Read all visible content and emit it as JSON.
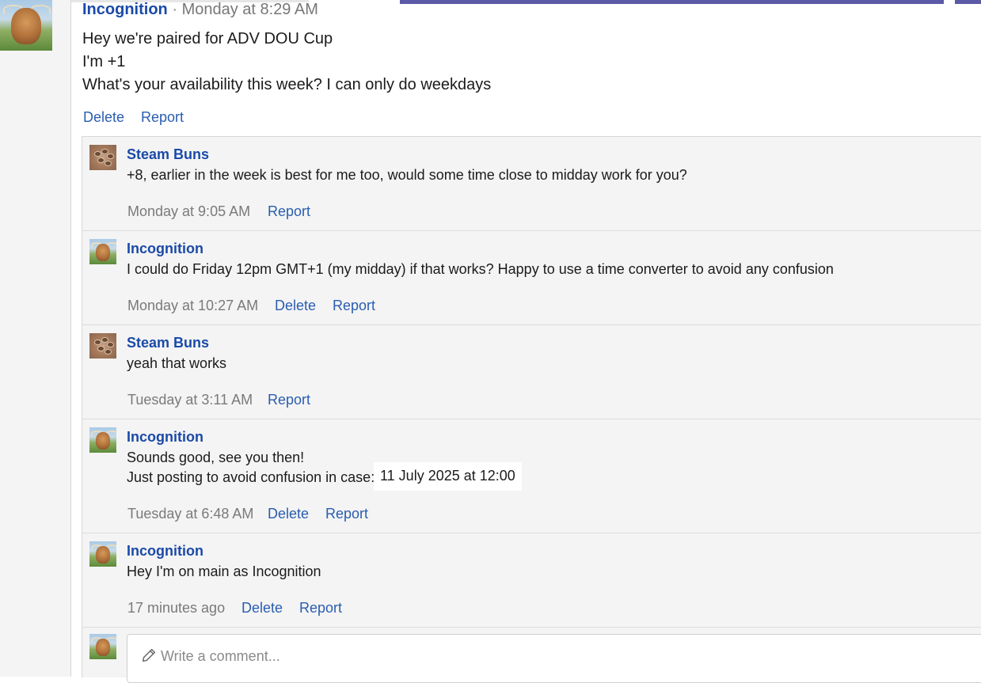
{
  "post": {
    "author": "Incognition",
    "separator": "·",
    "time": "Monday at 8:29 AM",
    "lines": [
      "Hey we're paired for ADV DOU Cup",
      "I'm +1",
      "What's your availability this week? I can only do weekdays"
    ],
    "actions": {
      "delete": "Delete",
      "report": "Report"
    }
  },
  "replies": [
    {
      "author": "Steam Buns",
      "text": "+8, earlier in the week is best for me too, would some time close to midday work for you?",
      "time": "Monday at 9:05 AM",
      "report": "Report"
    },
    {
      "author": "Incognition",
      "text": "I could do Friday 12pm GMT+1 (my midday) if that works? Happy to use a time converter to avoid any confusion",
      "time": "Monday at 10:27 AM",
      "delete": "Delete",
      "report": "Report"
    },
    {
      "author": "Steam Buns",
      "text": "yeah that works",
      "time": "Tuesday at 3:11 AM",
      "report": "Report"
    },
    {
      "author": "Incognition",
      "text": "Sounds good, see you then!",
      "text2": "Just posting to avoid confusion in case:",
      "date_chip": "11 July 2025 at 12:00",
      "time": "Tuesday at 6:48 AM",
      "delete": "Delete",
      "report": "Report"
    },
    {
      "author": "Incognition",
      "text": "Hey I'm on main as Incognition",
      "time": "17 minutes ago",
      "delete": "Delete",
      "report": "Report"
    }
  ],
  "composer": {
    "placeholder": "Write a comment...",
    "icon": "pencil-icon"
  },
  "avatars": {
    "incognition": "highland-cow-avatar",
    "steam_buns": "pinecone-avatar"
  },
  "colors": {
    "link": "#2a5db0",
    "author": "#1a4aa8",
    "reply_bg": "#f4f4f4",
    "top_accent": "#5a5aa6"
  }
}
